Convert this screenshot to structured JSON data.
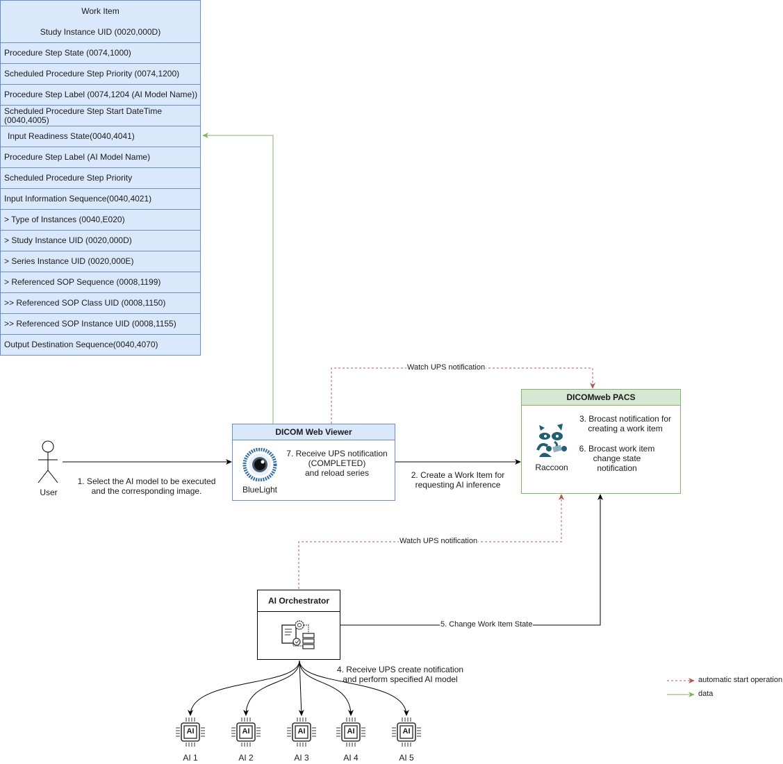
{
  "work_item": {
    "title": "Work Item",
    "rows": [
      "Study Instance UID (0020,000D)",
      "Procedure Step State (0074,1000)",
      "Scheduled Procedure Step Priority (0074,1200)",
      "Procedure Step Label (0074,1204 (AI Model Name))",
      "Scheduled Procedure Step Start DateTime (0040,4005)",
      "Input Readiness State(0040,4041)",
      "Procedure Step Label (AI Model Name)",
      "Scheduled Procedure Step Priority",
      "Input Information Sequence(0040,4021)",
      "> Type of Instances (0040,E020)",
      "> Study Instance UID (0020,000D)",
      "> Series Instance UID (0020,000E)",
      "> Referenced SOP Sequence (0008,1199)",
      ">> Referenced SOP Class UID (0008,1150)",
      ">> Referenced SOP Instance UID (0008,1155)",
      "Output Destination Sequence(0040,4070)"
    ]
  },
  "user": {
    "label": "User",
    "step1": [
      "1. Select the AI model to be executed",
      "and the corresponding image."
    ]
  },
  "viewer": {
    "title": "DICOM Web Viewer",
    "logo_label": "BlueLight",
    "step7": [
      "7. Receive UPS notification",
      "(COMPLETED)",
      "and reload series"
    ]
  },
  "pacs": {
    "title": "DICOMweb PACS",
    "logo_label": "Raccoon",
    "step3": [
      "3. Brocast notification for",
      "creating a work item"
    ],
    "step6": [
      "6. Brocast work item",
      "change state",
      "notification"
    ]
  },
  "edges": {
    "step2": [
      "2. Create a Work Item for",
      "requesting AI inference"
    ],
    "watch_top": "Watch UPS notification",
    "watch_bottom": "Watch UPS notification",
    "step5": "5. Change Work Item State",
    "step4": [
      "4. Receive UPS create notification",
      "and perform specified AI model"
    ]
  },
  "orchestrator": {
    "title": "AI Orchestrator"
  },
  "ai_models": [
    {
      "chip": "AI",
      "label": "AI 1"
    },
    {
      "chip": "AI",
      "label": "AI 2"
    },
    {
      "chip": "AI",
      "label": "AI 3"
    },
    {
      "chip": "AI",
      "label": "AI 4"
    },
    {
      "chip": "AI",
      "label": "AI 5"
    }
  ],
  "legend": {
    "items": [
      {
        "label": "automatic start operation",
        "color": "#b85450",
        "style": "dashed"
      },
      {
        "label": "data",
        "color": "#82b366",
        "style": "solid"
      }
    ]
  },
  "colors": {
    "blue_fill": "#dae8fc",
    "blue_stroke": "#6c8ebf",
    "green_fill": "#d5e8d4",
    "green_stroke": "#82b366",
    "red_dashed": "#b85450"
  }
}
